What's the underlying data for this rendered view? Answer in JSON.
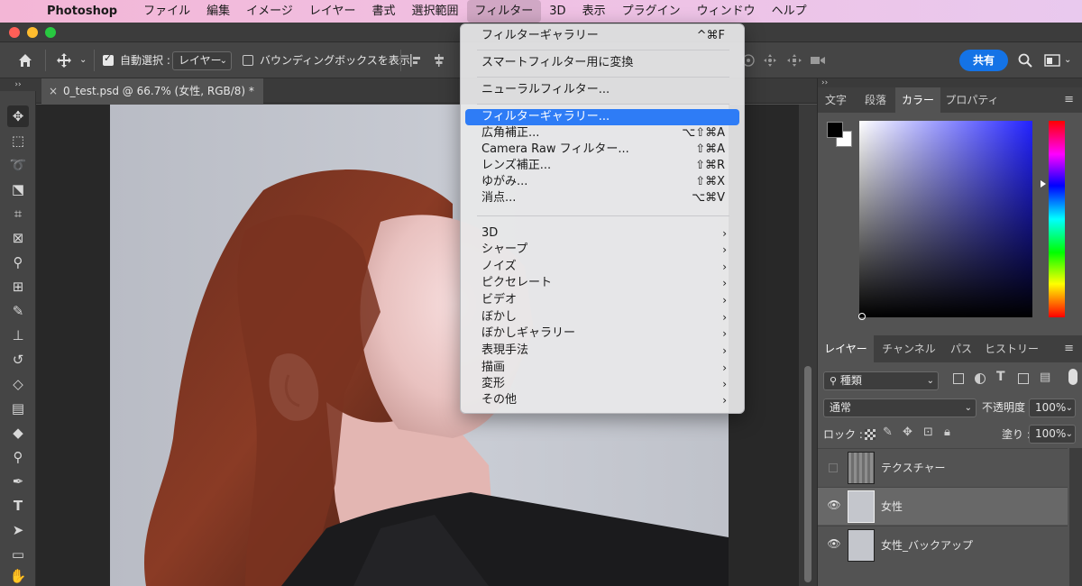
{
  "menubar": {
    "app_name": "Photoshop",
    "items": [
      "ファイル",
      "編集",
      "イメージ",
      "レイヤー",
      "書式",
      "選択範囲",
      "フィルター",
      "3D",
      "表示",
      "プラグイン",
      "ウィンドウ",
      "ヘルプ"
    ],
    "active": "フィルター"
  },
  "options": {
    "auto_select_label": "自動選択 :",
    "auto_select_target": "レイヤー",
    "bounding_box_label": "バウンディングボックスを表示",
    "share_label": "共有"
  },
  "document": {
    "tab_title": "0_test.psd @ 66.7% (女性, RGB/8) *"
  },
  "filter_menu": {
    "items": [
      {
        "label": "フィルターギャラリー",
        "shortcut": "^⌘F"
      },
      {
        "label": "スマートフィルター用に変換",
        "shortcut": ""
      },
      {
        "label": "ニューラルフィルター...",
        "shortcut": ""
      },
      {
        "label": "フィルターギャラリー...",
        "shortcut": ""
      },
      {
        "label": "広角補正...",
        "shortcut": "⌥⇧⌘A"
      },
      {
        "label": "Camera Raw フィルター...",
        "shortcut": "⇧⌘A"
      },
      {
        "label": "レンズ補正...",
        "shortcut": "⇧⌘R"
      },
      {
        "label": "ゆがみ...",
        "shortcut": "⇧⌘X"
      },
      {
        "label": "消点...",
        "shortcut": "⌥⌘V"
      },
      {
        "label": "3D",
        "shortcut": ""
      },
      {
        "label": "シャープ",
        "shortcut": ""
      },
      {
        "label": "ノイズ",
        "shortcut": ""
      },
      {
        "label": "ピクセレート",
        "shortcut": ""
      },
      {
        "label": "ビデオ",
        "shortcut": ""
      },
      {
        "label": "ぼかし",
        "shortcut": ""
      },
      {
        "label": "ぼかしギャラリー",
        "shortcut": ""
      },
      {
        "label": "表現手法",
        "shortcut": ""
      },
      {
        "label": "描画",
        "shortcut": ""
      },
      {
        "label": "変形",
        "shortcut": ""
      },
      {
        "label": "その他",
        "shortcut": ""
      }
    ],
    "highlighted": "フィルターギャラリー...",
    "submenu_arrow": "›"
  },
  "color_panel": {
    "tabs": [
      "文字",
      "段落",
      "カラー",
      "プロパティ"
    ],
    "active_tab": "カラー",
    "hue_color": "#2222ff"
  },
  "layers_panel": {
    "tabs": [
      "レイヤー",
      "チャンネル",
      "パス",
      "ヒストリー"
    ],
    "active_tab": "レイヤー",
    "filter_kind": "種類",
    "blend_mode": "通常",
    "opacity_label": "不透明度 :",
    "opacity_value": "100%",
    "lock_label": "ロック :",
    "fill_label": "塗り :",
    "fill_value": "100%",
    "layers": [
      {
        "name": "テクスチャー",
        "visible": false,
        "selected": false
      },
      {
        "name": "女性",
        "visible": true,
        "selected": true
      },
      {
        "name": "女性_バックアップ",
        "visible": true,
        "selected": false
      }
    ]
  }
}
